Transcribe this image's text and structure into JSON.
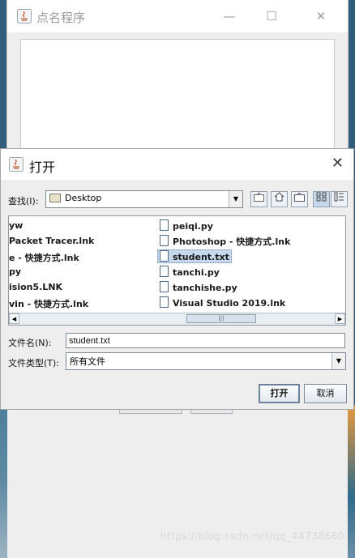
{
  "background_window": {
    "title": "点名程序",
    "minimize_label": "—",
    "maximize_label": "☐",
    "close_label": "✕"
  },
  "dialog": {
    "title": "打开",
    "close_label": "✕",
    "look_in_label": "查找(I):",
    "look_in_value": "Desktop",
    "toolbar_icons": [
      "up-folder-icon",
      "home-icon",
      "new-folder-icon",
      "list-view-icon",
      "details-view-icon"
    ],
    "files": [
      {
        "name": "yw",
        "column": 1,
        "icon": false
      },
      {
        "name": "Packet Tracer.lnk",
        "column": 1,
        "icon": false
      },
      {
        "name": "e - 快捷方式.lnk",
        "column": 1,
        "icon": false
      },
      {
        "name": "py",
        "column": 1,
        "icon": false
      },
      {
        "name": "ision5.LNK",
        "column": 1,
        "icon": false
      },
      {
        "name": "vin - 快捷方式.lnk",
        "column": 1,
        "icon": false
      },
      {
        "name": "peiqi.py",
        "column": 2,
        "icon": true
      },
      {
        "name": "Photoshop - 快捷方式.lnk",
        "column": 2,
        "icon": true
      },
      {
        "name": "student.txt",
        "column": 2,
        "icon": true,
        "selected": true
      },
      {
        "name": "tanchi.py",
        "column": 2,
        "icon": true
      },
      {
        "name": "tanchishe.py",
        "column": 2,
        "icon": true
      },
      {
        "name": "Visual Studio 2019.lnk",
        "column": 2,
        "icon": true
      }
    ],
    "scroll_left": "◀",
    "scroll_right": "▶",
    "scroll_grip": "|||",
    "filename_label": "文件名(N):",
    "filename_value": "student.txt",
    "filetype_label": "文件类型(T):",
    "filetype_value": "所有文件",
    "dropdown_arrow": "▼",
    "open_button": "打开",
    "cancel_button": "取消"
  },
  "watermark": "https://blog.csdn.net/qq_44738660",
  "colors": {
    "accent": "#6c829a",
    "selection": "#c6d9ee",
    "background": "#eeeeee"
  }
}
